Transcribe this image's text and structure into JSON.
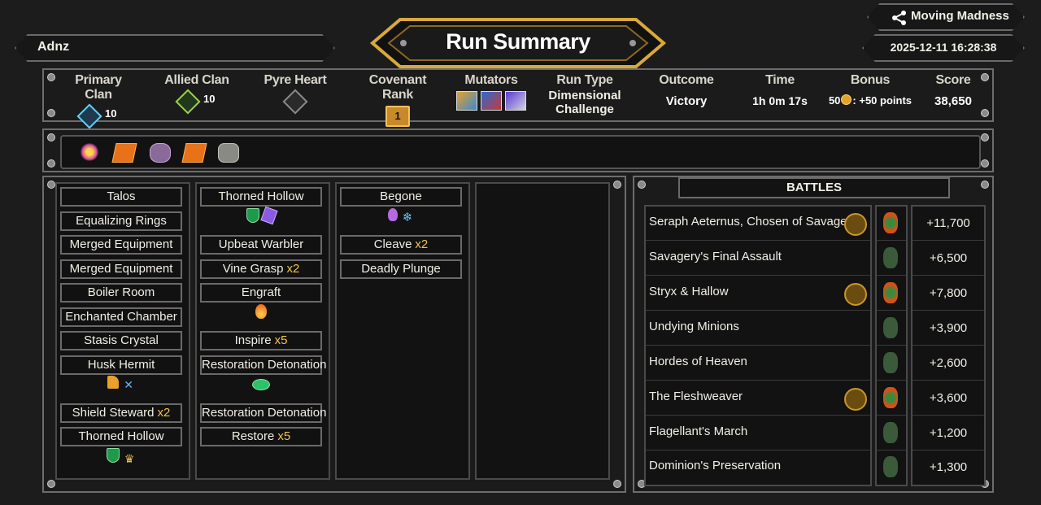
{
  "player": {
    "name": "Adnz"
  },
  "title": "Run Summary",
  "share": {
    "label": "Moving Madness"
  },
  "timestamp": "2025-12-11 16:28:38",
  "stats": {
    "primary_clan": {
      "label": "Primary Clan",
      "level": "10"
    },
    "allied_clan": {
      "label": "Allied Clan",
      "level": "10"
    },
    "pyre_heart": {
      "label": "Pyre Heart"
    },
    "covenant_rank": {
      "label": "Covenant Rank",
      "value": "1"
    },
    "mutators": {
      "label": "Mutators"
    },
    "run_type": {
      "label": "Run Type",
      "value_line1": "Dimensional",
      "value_line2": "Challenge"
    },
    "outcome": {
      "label": "Outcome",
      "value": "Victory"
    },
    "time": {
      "label": "Time",
      "value": "1h 0m 17s"
    },
    "bonus": {
      "label": "Bonus",
      "value_prefix": "50",
      "value_suffix": ": +50 points"
    },
    "score": {
      "label": "Score",
      "value": "38,650"
    }
  },
  "relics": [
    "flower-relic-icon",
    "orange-gem-relic-icon",
    "beast-relic-icon",
    "orange-gem-relic-icon",
    "stone-relic-icon"
  ],
  "deck": {
    "col1": [
      {
        "name": "Talos"
      },
      {
        "name": "Equalizing Rings"
      },
      {
        "name": "Merged Equipment"
      },
      {
        "name": "Merged Equipment"
      },
      {
        "name": "Boiler Room"
      },
      {
        "name": "Enchanted Chamber"
      },
      {
        "name": "Stasis Crystal"
      },
      {
        "name": "Husk Hermit"
      },
      {
        "name": "Shield Steward",
        "mult": "x2"
      },
      {
        "name": "Thorned Hollow"
      }
    ],
    "col2": [
      {
        "name": "Thorned Hollow"
      },
      {
        "name": "Upbeat Warbler"
      },
      {
        "name": "Vine Grasp",
        "mult": "x2"
      },
      {
        "name": "Engraft"
      },
      {
        "name": "Inspire",
        "mult": "x5"
      },
      {
        "name": "Restoration Detonation"
      },
      {
        "name": "Restoration Detonation"
      },
      {
        "name": "Restore",
        "mult": "x5"
      }
    ],
    "col3": [
      {
        "name": "Begone"
      },
      {
        "name": "Cleave",
        "mult": "x2"
      },
      {
        "name": "Deadly Plunge"
      }
    ]
  },
  "battles": {
    "title": "BATTLES",
    "rows": [
      {
        "name": "Seraph Aeternus, Chosen of Savagery",
        "score": "+11,700",
        "champion": true,
        "boss": true
      },
      {
        "name": "Savagery's Final Assault",
        "score": "+6,500",
        "champion": false,
        "boss": false
      },
      {
        "name": "Stryx & Hallow",
        "score": "+7,800",
        "champion": true,
        "boss": true
      },
      {
        "name": "Undying Minions",
        "score": "+3,900",
        "champion": false,
        "boss": false
      },
      {
        "name": "Hordes of Heaven",
        "score": "+2,600",
        "champion": false,
        "boss": false
      },
      {
        "name": "The Fleshweaver",
        "score": "+3,600",
        "champion": true,
        "boss": true
      },
      {
        "name": "Flagellant's March",
        "score": "+1,200",
        "champion": false,
        "boss": false
      },
      {
        "name": "Dominion's Preservation",
        "score": "+1,300",
        "champion": false,
        "boss": false
      }
    ]
  },
  "colors": {
    "accent_gold": "#f3c24a",
    "frame": "#6d6d6d",
    "background": "#1c1c1c"
  }
}
